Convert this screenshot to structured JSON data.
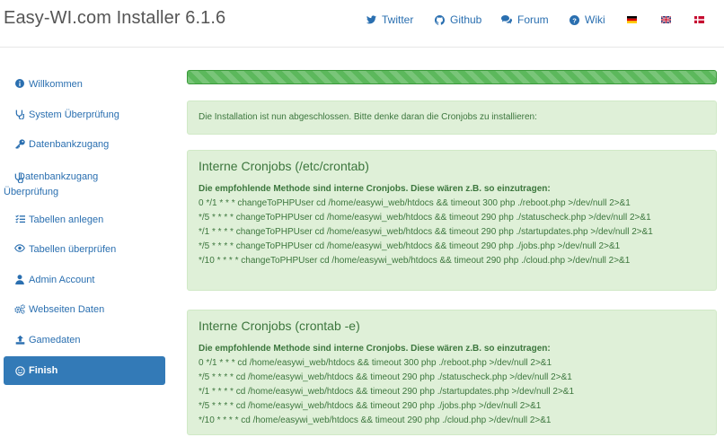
{
  "header": {
    "title": "Easy-WI.com Installer 6.1.6",
    "nav": [
      {
        "label": "Twitter",
        "icon": "twitter-icon"
      },
      {
        "label": "Github",
        "icon": "github-icon"
      },
      {
        "label": "Forum",
        "icon": "comments-icon"
      },
      {
        "label": "Wiki",
        "icon": "question-circle-icon"
      }
    ],
    "flags": [
      "de-flag-icon",
      "uk-flag-icon",
      "dk-flag-icon"
    ]
  },
  "sidebar": {
    "items": [
      {
        "label": "Willkommen",
        "icon": "info-circle-icon"
      },
      {
        "label": "System Überprüfung",
        "icon": "stethoscope-icon"
      },
      {
        "label": "Datenbankzugang",
        "icon": "key-icon"
      },
      {
        "label": "Datenbankzugang Überprüfung",
        "icon": "stethoscope-icon"
      },
      {
        "label": "Tabellen anlegen",
        "icon": "list-icon"
      },
      {
        "label": "Tabellen überprüfen",
        "icon": "eye-icon"
      },
      {
        "label": "Admin Account",
        "icon": "user-icon"
      },
      {
        "label": "Webseiten Daten",
        "icon": "cogs-icon"
      },
      {
        "label": "Gamedaten",
        "icon": "upload-icon"
      },
      {
        "label": "Finish",
        "icon": "smile-icon",
        "active": true
      }
    ]
  },
  "progress": {
    "percent": 100,
    "color": "#5cb85c"
  },
  "main": {
    "done_message": "Die Installation ist nun abgeschlossen. Bitte denke daran die Cronjobs zu installieren:",
    "panels": [
      {
        "title": "Interne Cronjobs (/etc/crontab)",
        "intro": "Die empfohlende Methode sind interne Cronjobs. Diese wären z.B. so einzutragen:",
        "lines": [
          "0 */1 * * * changeToPHPUser cd /home/easywi_web/htdocs && timeout 300 php ./reboot.php >/dev/null 2>&1",
          "*/5 * * * * changeToPHPUser cd /home/easywi_web/htdocs && timeout 290 php ./statuscheck.php >/dev/null 2>&1",
          "*/1 * * * * changeToPHPUser cd /home/easywi_web/htdocs && timeout 290 php ./startupdates.php >/dev/null 2>&1",
          "*/5 * * * * changeToPHPUser cd /home/easywi_web/htdocs && timeout 290 php ./jobs.php >/dev/null 2>&1",
          "*/10 * * * * changeToPHPUser cd /home/easywi_web/htdocs && timeout 290 php ./cloud.php >/dev/null 2>&1"
        ]
      },
      {
        "title": "Interne Cronjobs (crontab -e)",
        "intro": "Die empfohlende Methode sind interne Cronjobs. Diese wären z.B. so einzutragen:",
        "lines": [
          "0 */1 * * * cd /home/easywi_web/htdocs && timeout 300 php ./reboot.php >/dev/null 2>&1",
          "*/5 * * * * cd /home/easywi_web/htdocs && timeout 290 php ./statuscheck.php >/dev/null 2>&1",
          "*/1 * * * * cd /home/easywi_web/htdocs && timeout 290 php ./startupdates.php >/dev/null 2>&1",
          "*/5 * * * * cd /home/easywi_web/htdocs && timeout 290 php ./jobs.php >/dev/null 2>&1",
          "*/10 * * * * cd /home/easywi_web/htdocs && timeout 290 php ./cloud.php >/dev/null 2>&1"
        ]
      }
    ]
  }
}
